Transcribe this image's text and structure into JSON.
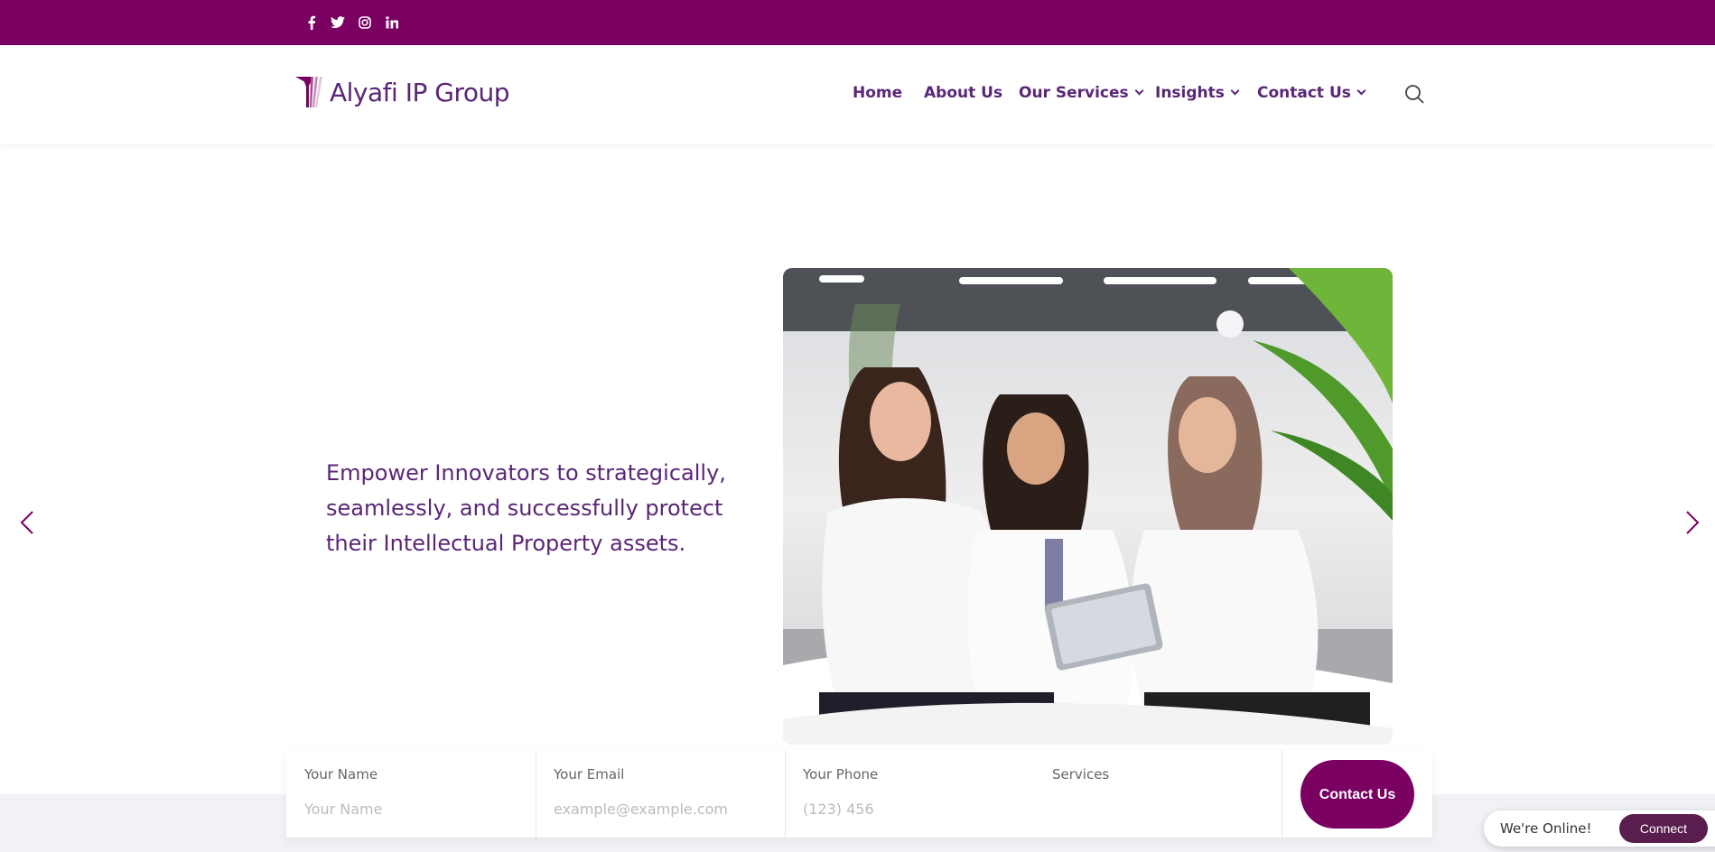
{
  "brand": {
    "name": "Alyafi IP Group",
    "primary_color": "#7a0062",
    "text_color": "#5a2676"
  },
  "social_icons": [
    "facebook-icon",
    "twitter-icon",
    "instagram-icon",
    "linkedin-icon"
  ],
  "nav": {
    "items": [
      {
        "label": "Home",
        "dropdown": false
      },
      {
        "label": "About Us",
        "dropdown": false
      },
      {
        "label": "Our Services",
        "dropdown": true
      },
      {
        "label": "Insights",
        "dropdown": true
      },
      {
        "label": "Contact Us",
        "dropdown": true
      }
    ],
    "search_icon": "search-icon"
  },
  "hero": {
    "text": "Empower Innovators to strategically, seamlessly, and successfully protect their Intellectual Property assets.",
    "prev_icon": "chevron-left-icon",
    "next_icon": "chevron-right-icon"
  },
  "form": {
    "name_label": "Your Name",
    "name_placeholder": "Your Name",
    "email_label": "Your Email",
    "email_placeholder": "example@example.com",
    "phone_label": "Your Phone",
    "phone_placeholder": "(123) 456",
    "services_label": "Services",
    "submit_label": "Contact Us"
  },
  "chat": {
    "status": "We're Online!",
    "button": "Connect"
  }
}
